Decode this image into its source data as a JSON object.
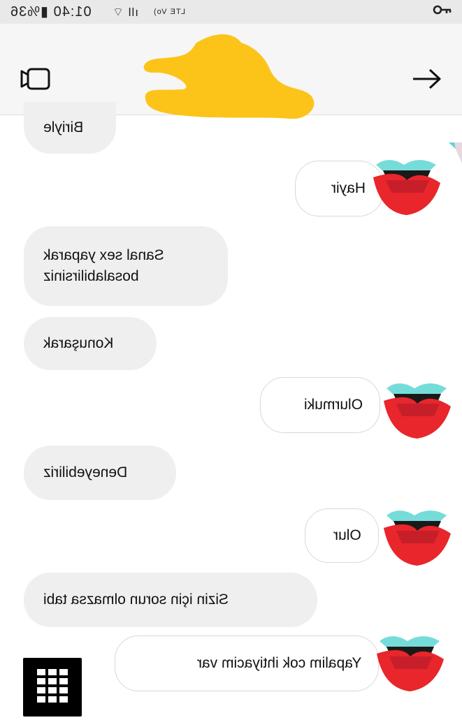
{
  "status_bar": {
    "time_battery": "01:40 ▮%36",
    "network": "LTE Vo)"
  },
  "header": {
    "video_icon": "video-call-icon",
    "forward_icon": "arrow-right-icon"
  },
  "messages": [
    {
      "side": "incoming",
      "text": "Biriyle"
    },
    {
      "side": "outgoing",
      "text": "Hayir"
    },
    {
      "side": "incoming",
      "text": "Sanal sex yaparak bosalabilirsiniz"
    },
    {
      "side": "incoming",
      "text": "Konuşarak"
    },
    {
      "side": "outgoing",
      "text": "Olurmuki"
    },
    {
      "side": "incoming",
      "text": "Deneyebiliriz"
    },
    {
      "side": "outgoing",
      "text": "Olur"
    },
    {
      "side": "incoming",
      "text": "Sizin için sorun olmazsa tabi"
    },
    {
      "side": "outgoing",
      "text": "Yapalim cok ihtiyacim var"
    }
  ],
  "colors": {
    "lips_red": "#e8262b",
    "lips_teal": "#5ed6d3",
    "scribble_yellow": "#fcc419",
    "incoming_bubble": "#efefef"
  },
  "keypad_icon": "keypad-grid-icon"
}
